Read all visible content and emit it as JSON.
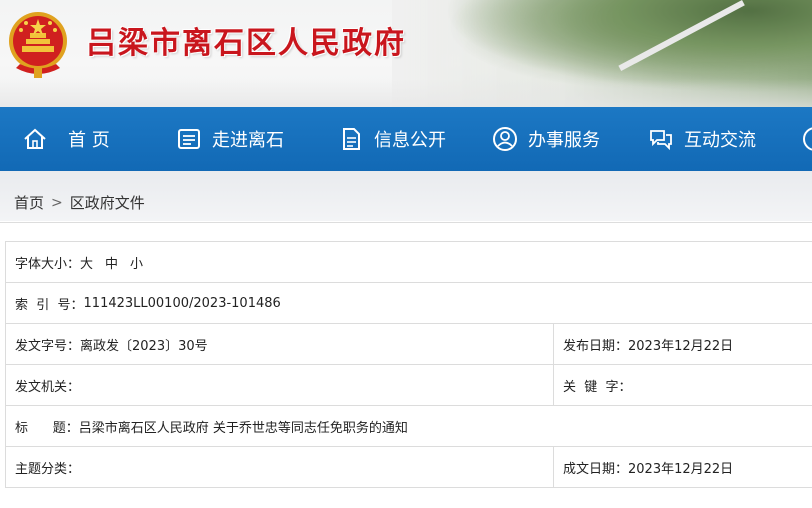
{
  "header": {
    "site_title": "吕梁市离石区人民政府",
    "emblem_icon": "national-emblem-icon"
  },
  "nav": {
    "items": [
      {
        "label": "首 页",
        "icon": "home-icon"
      },
      {
        "label": "走进离石",
        "icon": "list-card-icon"
      },
      {
        "label": "信息公开",
        "icon": "document-icon"
      },
      {
        "label": "办事服务",
        "icon": "user-service-icon"
      },
      {
        "label": "互动交流",
        "icon": "chat-bubbles-icon"
      }
    ],
    "bg_color": "#1a73be"
  },
  "breadcrumb": {
    "home": "首页",
    "separator": ">",
    "current": "区政府文件"
  },
  "info": {
    "font_size": {
      "label": "字体大小：",
      "large": "大",
      "medium": "中",
      "small": "小"
    },
    "index_no": {
      "label": "索  引  号：",
      "value": "111423LL00100/2023-101486"
    },
    "doc_no": {
      "label": "发文字号：",
      "value": "离政发〔2023〕30号"
    },
    "publish_date": {
      "label": "发布日期：",
      "value": "2023年12月22日"
    },
    "issuer": {
      "label": "发文机关：",
      "value": ""
    },
    "keywords": {
      "label": "关  键  字：",
      "value": ""
    },
    "title": {
      "label": "标      题：",
      "value": "吕梁市离石区人民政府 关于乔世忠等同志任免职务的通知"
    },
    "subject": {
      "label": "主题分类：",
      "value": ""
    },
    "created_date": {
      "label": "成文日期：",
      "value": "2023年12月22日"
    }
  },
  "colors": {
    "title_red": "#c9161d",
    "nav_blue": "#1a73be"
  }
}
